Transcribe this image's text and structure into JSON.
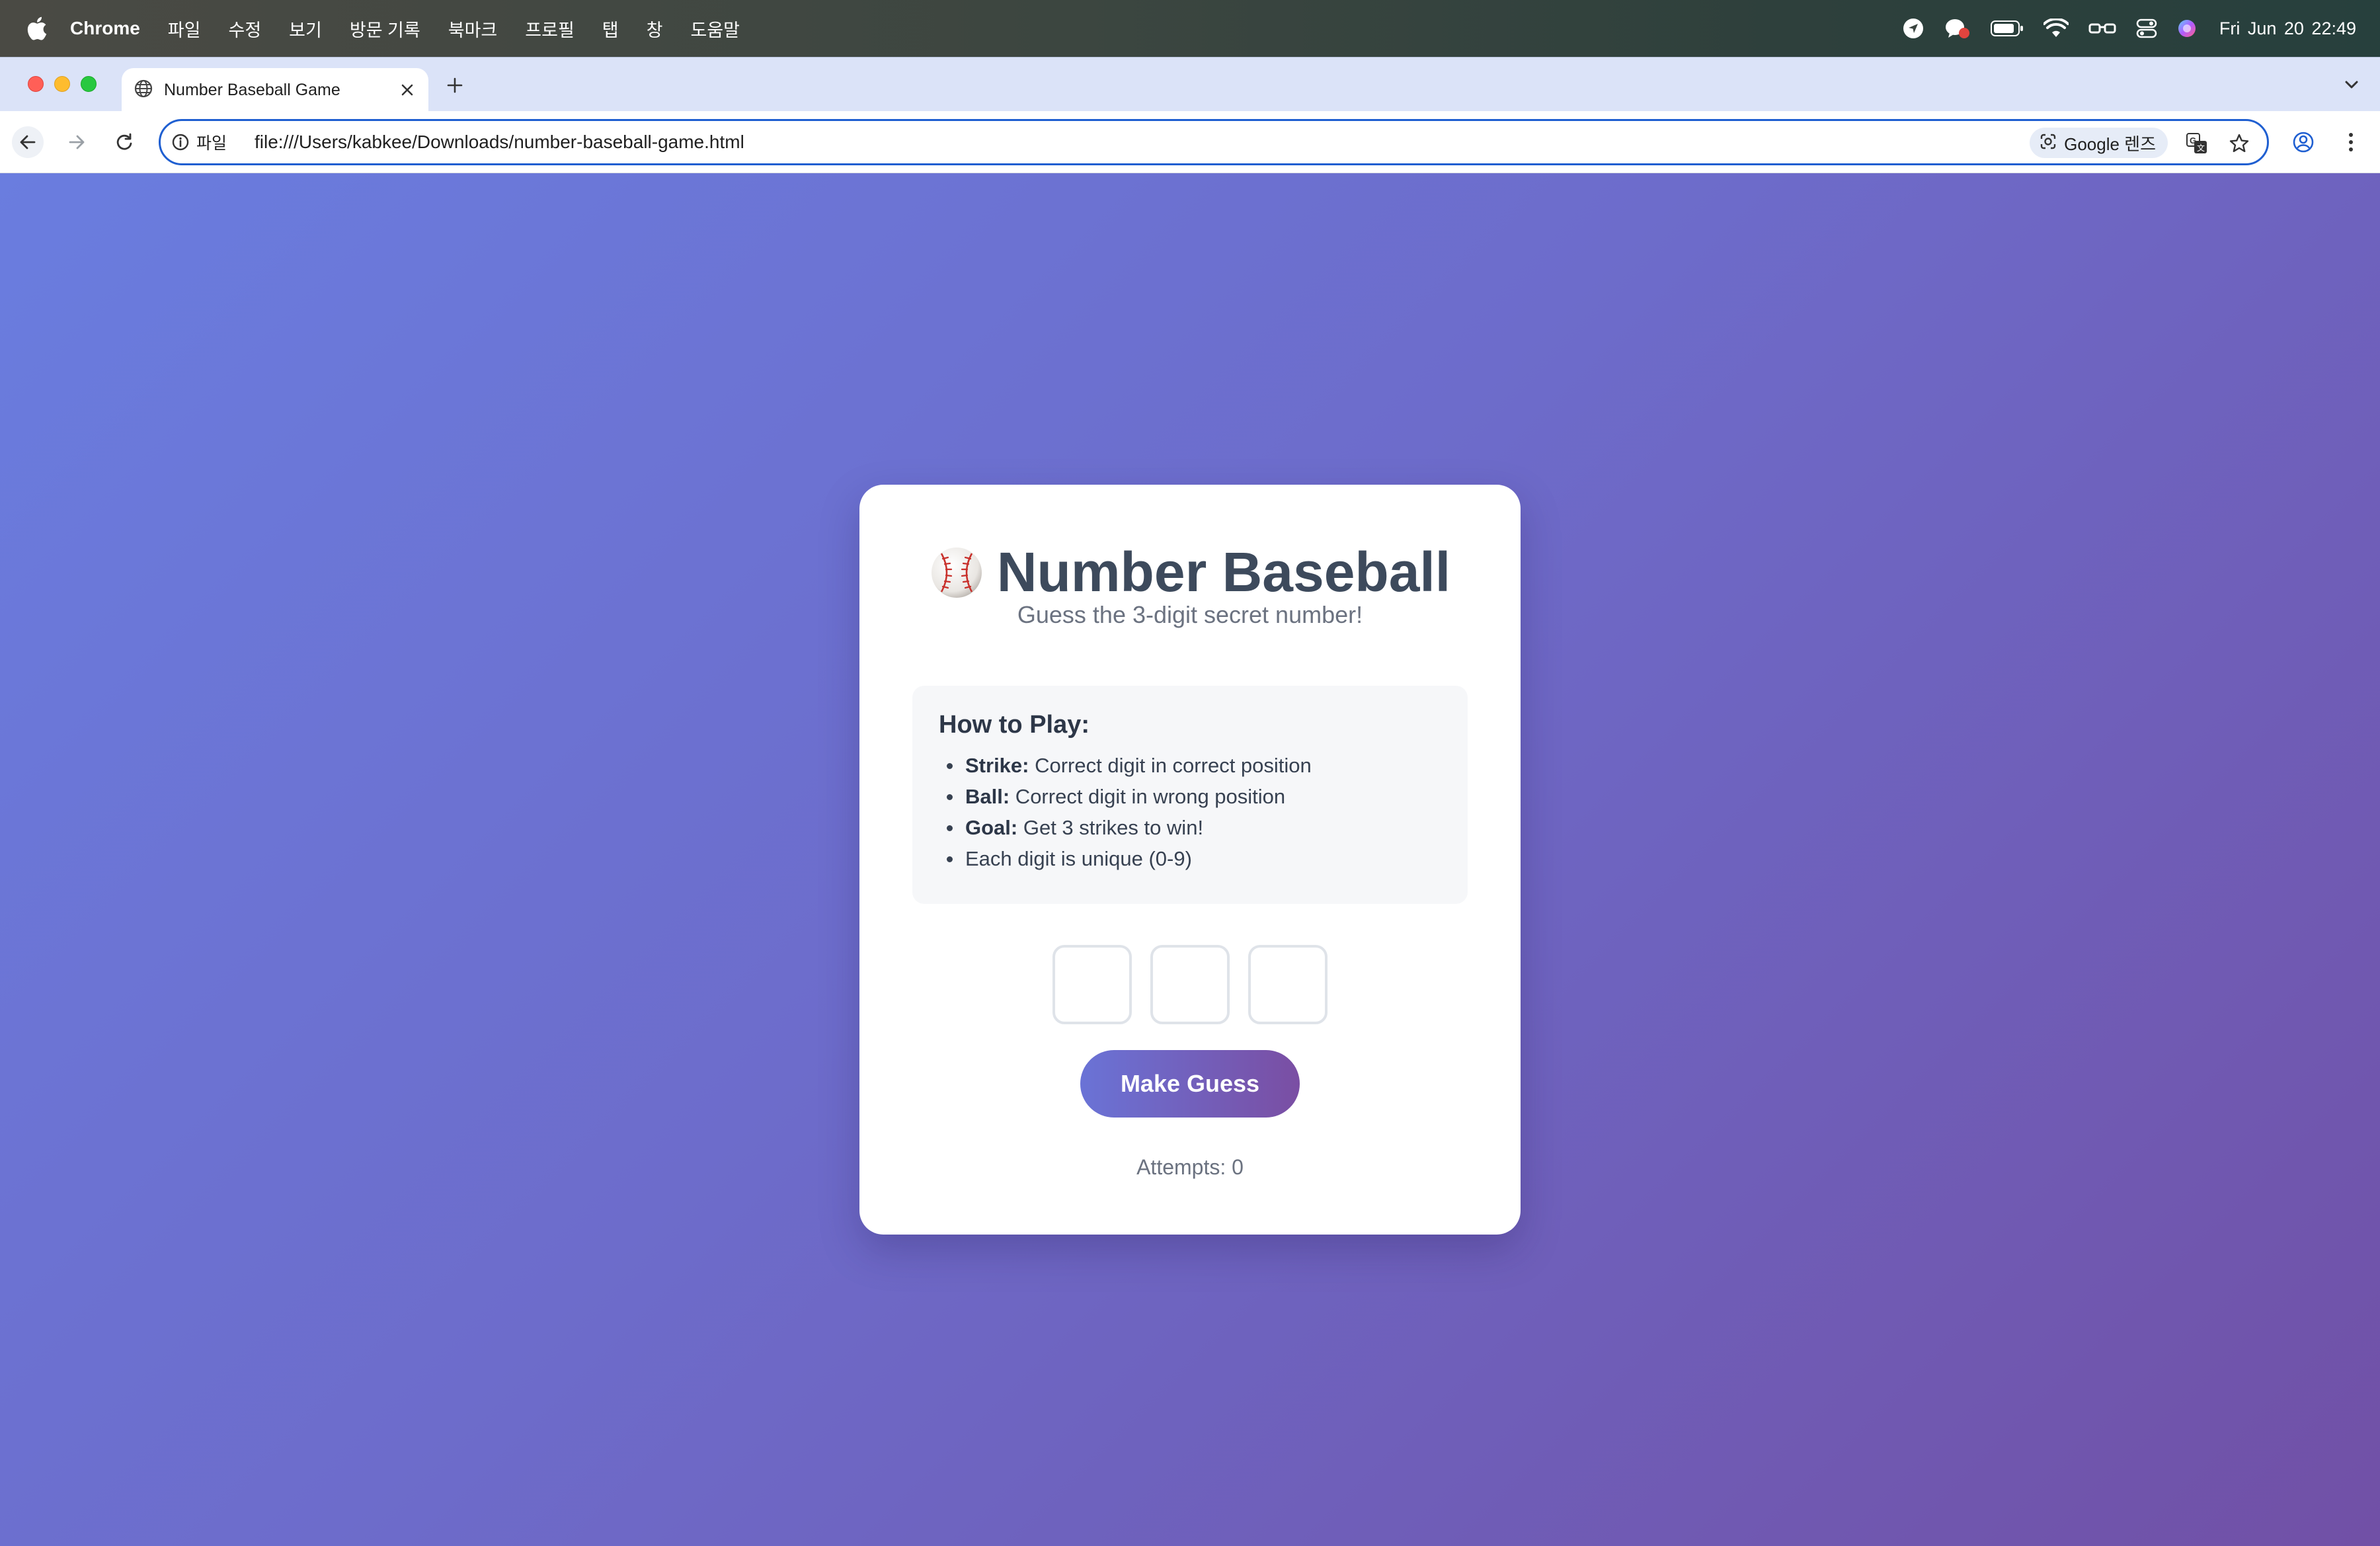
{
  "menubar": {
    "app_name": "Chrome",
    "items": [
      "파일",
      "수정",
      "보기",
      "방문 기록",
      "북마크",
      "프로필",
      "탭",
      "창",
      "도움말"
    ],
    "clock": "Fri Jun 20  22:49"
  },
  "browser": {
    "tab_title": "Number Baseball Game",
    "url_scheme_label": "파일",
    "url": "file:///Users/kabkee/Downloads/number-baseball-game.html",
    "lens_label": "Google 렌즈"
  },
  "game": {
    "icon": "baseball-icon",
    "title": "Number Baseball",
    "subtitle": "Guess the 3-digit secret number!",
    "rules_title": "How to Play:",
    "rules": [
      {
        "term": "Strike:",
        "text": " Correct digit in correct position"
      },
      {
        "term": "Ball:",
        "text": " Correct digit in wrong position"
      },
      {
        "term": "Goal:",
        "text": " Get 3 strikes to win!"
      },
      {
        "term": "",
        "text": "Each digit is unique (0-9)"
      }
    ],
    "digit_values": [
      "",
      "",
      ""
    ],
    "button_label": "Make Guess",
    "attempts_label": "Attempts: 0"
  },
  "colors": {
    "background_start": "#6a7ddf",
    "background_end": "#7150a6",
    "button_start": "#6a73d6",
    "button_end": "#7a4ea3",
    "title_text": "#3d4a5c"
  }
}
